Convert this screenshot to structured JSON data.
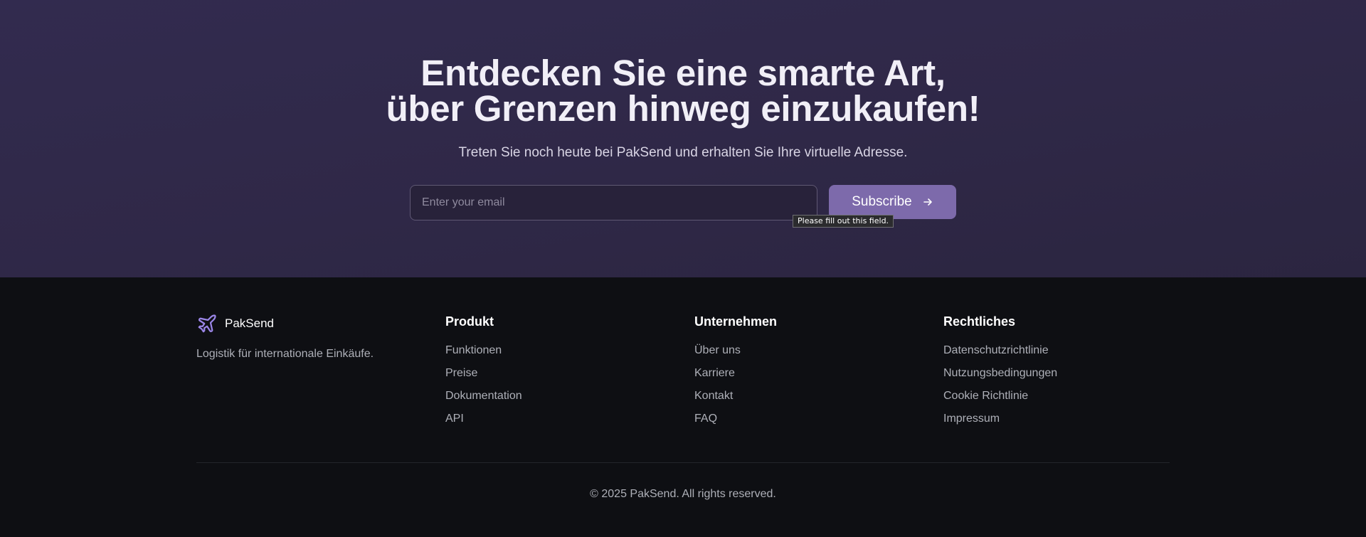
{
  "hero": {
    "title_line1": "Entdecken Sie eine smarte Art,",
    "title_line2": "über Grenzen hinweg einzukaufen!",
    "subtitle": "Treten Sie noch heute bei PakSend und erhalten Sie Ihre virtuelle Adresse.",
    "email_placeholder": "Enter your email",
    "email_value": "",
    "subscribe_label": "Subscribe",
    "subscribe_icon": "arrow-right-icon",
    "validation_tooltip": "Please fill out this field."
  },
  "footer": {
    "brand": {
      "name": "PakSend",
      "logo_icon": "airplane-icon",
      "tagline": "Logistik für internationale Einkäufe."
    },
    "columns": [
      {
        "title": "Produkt",
        "links": [
          "Funktionen",
          "Preise",
          "Dokumentation",
          "API"
        ]
      },
      {
        "title": "Unternehmen",
        "links": [
          "Über uns",
          "Karriere",
          "Kontakt",
          "FAQ"
        ]
      },
      {
        "title": "Rechtliches",
        "links": [
          "Datenschutzrichtlinie",
          "Nutzungsbedingungen",
          "Cookie Richtlinie",
          "Impressum"
        ]
      }
    ],
    "copyright": "© 2025 PakSend. All rights reserved."
  },
  "colors": {
    "hero_background": "#302a4a",
    "footer_background": "#0e0f13",
    "accent": "#7d6aab",
    "logo": "#9b86e8"
  }
}
